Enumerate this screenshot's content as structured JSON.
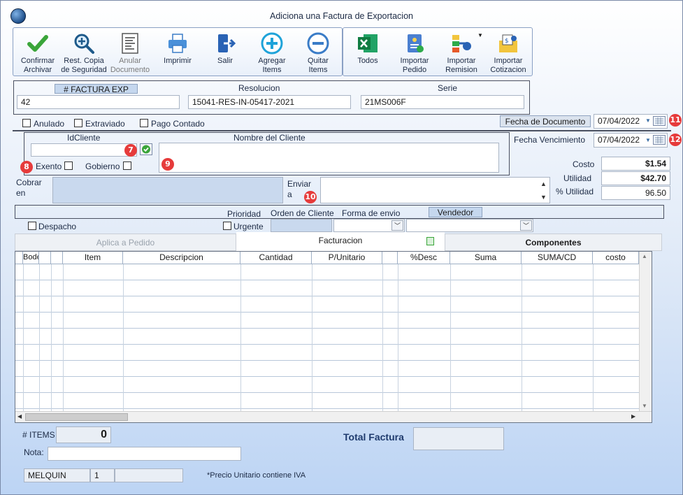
{
  "window": {
    "title": "Adiciona una Factura de Exportacion"
  },
  "toolbar": {
    "confirm": "Confirmar\nArchivar",
    "restore": "Rest. Copia\nde Seguridad",
    "cancel_doc": "Anular\nDocumento",
    "print": "Imprimir",
    "exit": "Salir",
    "add_items": "Agregar\nItems",
    "remove_items": "Quitar\nItems",
    "all": "Todos",
    "import_order": "Importar\nPedido",
    "import_remision": "Importar\nRemision",
    "import_quote": "Importar\nCotizacion"
  },
  "header": {
    "factura_label": "# FACTURA EXP",
    "factura_value": "42",
    "resolucion_label": "Resolucion",
    "resolucion_value": "15041-RES-IN-05417-2021",
    "serie_label": "Serie",
    "serie_value": "21MS006F"
  },
  "flags": {
    "anulado": "Anulado",
    "extraviado": "Extraviado",
    "pago_contado": "Pago Contado"
  },
  "fecha_documento": {
    "label": "Fecha de  Documento",
    "value": "07/04/2022"
  },
  "fecha_vencimiento": {
    "label": "Fecha Vencimiento",
    "value": "07/04/2022"
  },
  "cliente": {
    "id_label": "IdCliente",
    "id_value": "",
    "nombre_label": "Nombre del Cliente",
    "nombre_value": "",
    "exento": "Exento",
    "gobierno": "Gobierno"
  },
  "badges": {
    "b7": "7",
    "b8": "8",
    "b9": "9",
    "b10": "10",
    "b11": "11",
    "b12": "12"
  },
  "cobrar": {
    "label1": "Cobrar",
    "label2": "en",
    "value": ""
  },
  "enviar": {
    "label1": "Enviar",
    "label2": "a",
    "value": ""
  },
  "totals": {
    "costo_label": "Costo",
    "costo_value": "$1.54",
    "utilidad_label": "Utilidad",
    "utilidad_value": "$42.70",
    "pct_label": "% Utilidad",
    "pct_value": "96.50"
  },
  "shipping": {
    "prioridad": "Prioridad",
    "orden_cliente": "Orden de Cliente",
    "forma_envio": "Forma de envio",
    "vendedor": "Vendedor",
    "despacho": "Despacho",
    "urgente": "Urgente",
    "orden_value": ""
  },
  "tabs": {
    "aplica": "Aplica a Pedido",
    "facturacion": "Facturacion",
    "componentes": "Componentes"
  },
  "grid": {
    "columns": [
      "Bodega",
      "",
      "Item",
      "Descripcion",
      "Cantidad",
      "P/Unitario",
      "",
      "%Desc",
      "Suma",
      "SUMA/CD",
      "costo"
    ]
  },
  "footer": {
    "items_label": "# ITEMS",
    "items_value": "0",
    "nota_label": "Nota:",
    "nota_value": "",
    "total_label": "Total Factura",
    "total_value": "",
    "user": "MELQUIN",
    "user_num": "1",
    "user_extra": "",
    "iva_note": "*Precio Unitario contiene IVA"
  }
}
